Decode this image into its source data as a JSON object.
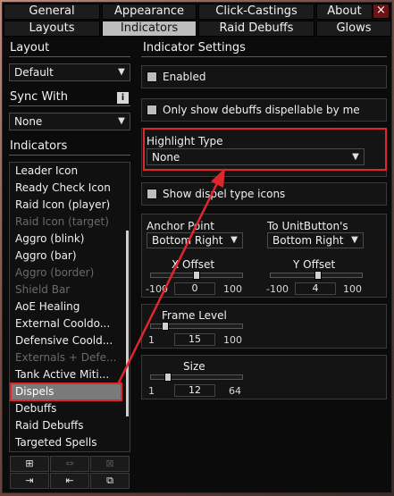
{
  "tabs_top": [
    "General",
    "Appearance",
    "Click-Castings",
    "About"
  ],
  "tabs_bottom": [
    "Layouts",
    "Indicators",
    "Raid Debuffs",
    "Glows"
  ],
  "active_tab": "Indicators",
  "close_label": "×",
  "sidebar": {
    "layout_header": "Layout",
    "layout_value": "Default",
    "sync_header": "Sync With",
    "sync_value": "None",
    "indicators_header": "Indicators",
    "items": [
      {
        "label": "Leader Icon"
      },
      {
        "label": "Ready Check Icon"
      },
      {
        "label": "Raid Icon (player)"
      },
      {
        "label": "Raid Icon (target)"
      },
      {
        "label": "Aggro (blink)"
      },
      {
        "label": "Aggro (bar)"
      },
      {
        "label": "Aggro (border)"
      },
      {
        "label": "Shield Bar"
      },
      {
        "label": "AoE Healing"
      },
      {
        "label": "External Cooldo..."
      },
      {
        "label": "Defensive Coold..."
      },
      {
        "label": "Externals + Defe..."
      },
      {
        "label": "Tank Active Miti..."
      },
      {
        "label": "Dispels"
      },
      {
        "label": "Debuffs"
      },
      {
        "label": "Raid Debuffs"
      },
      {
        "label": "Targeted Spells"
      }
    ]
  },
  "settings": {
    "header": "Indicator Settings",
    "enabled_label": "Enabled",
    "only_dispellable_label": "Only show debuffs dispellable by me",
    "highlight_type_label": "Highlight Type",
    "highlight_type_value": "None",
    "show_dispel_icons_label": "Show dispel type icons",
    "anchor_point_label": "Anchor Point",
    "anchor_point_value": "Bottom Right",
    "to_unitbutton_label": "To UnitButton's",
    "to_unitbutton_value": "Bottom Right",
    "x_offset": {
      "label": "X Offset",
      "min": "-100",
      "max": "100",
      "value": "0",
      "fraction": 0.5
    },
    "y_offset": {
      "label": "Y Offset",
      "min": "-100",
      "max": "100",
      "value": "4",
      "fraction": 0.52
    },
    "frame_level": {
      "label": "Frame Level",
      "min": "1",
      "max": "100",
      "value": "15",
      "fraction": 0.14
    },
    "size": {
      "label": "Size",
      "min": "1",
      "max": "64",
      "value": "12",
      "fraction": 0.17
    }
  },
  "colors": {
    "highlight_red": "#e0262b",
    "active_tab": "#bdbdbd",
    "close_button": "#6e1313"
  }
}
